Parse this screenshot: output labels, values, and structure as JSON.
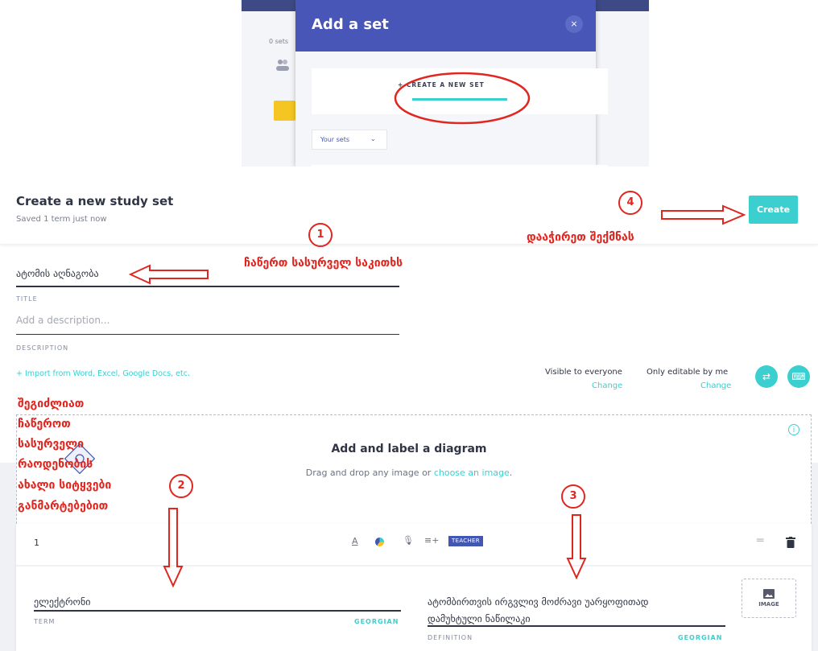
{
  "modal": {
    "title": "Add a set",
    "close_icon": "×",
    "create_link": "+ CREATE A NEW SET",
    "your_sets_select": "Your sets",
    "side_left_text": "0 sets"
  },
  "header": {
    "title": "Create a new study set",
    "saved": "Saved 1 term just now",
    "create_button": "Create"
  },
  "form": {
    "title_value": "ატომის აღნაგობა",
    "title_label": "TITLE",
    "description_placeholder": "Add a description...",
    "description_label": "DESCRIPTION",
    "import_link": "+ Import from Word, Excel, Google Docs, etc.",
    "visibility_label": "Visible to everyone",
    "visibility_change": "Change",
    "editable_label": "Only editable by me",
    "editable_change": "Change"
  },
  "diagram": {
    "title": "Add and label a diagram",
    "subtitle_prefix": "Drag and drop any image or ",
    "subtitle_link": "choose an image",
    "subtitle_suffix": "."
  },
  "card": {
    "number": "1",
    "teacher_badge": "TEACHER",
    "term_value": "ელექტრონი",
    "term_label": "TERM",
    "term_language": "GEORGIAN",
    "definition_line1": "ატომბირთვის ირგვლივ მოძრავი უარყოფითად",
    "definition_line2": "დამუხტული ნაწილაკი",
    "definition_label": "DEFINITION",
    "definition_language": "GEORGIAN",
    "image_label": "IMAGE"
  },
  "annotations": {
    "circle1": "1",
    "circle2": "2",
    "circle3": "3",
    "circle4": "4",
    "title_hint": "ჩაწერთ სასურველ საკითხს",
    "create_hint": "დააჭირეთ შექმნას",
    "terms_hint": [
      "შეგიძლიათ",
      "ჩაწეროთ",
      "სასურველი",
      "რაოდენობის",
      "ახალი სიტყვები",
      "განმარტებებით"
    ]
  },
  "colors": {
    "accent": "#3ccfcf",
    "modal_header": "#4756b7",
    "annotation_red": "#e0261f",
    "text_dark": "#303545"
  }
}
